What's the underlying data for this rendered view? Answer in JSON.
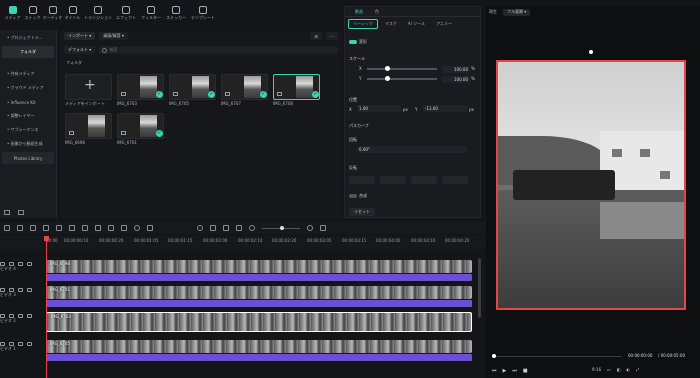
{
  "media_tabs": [
    {
      "label": "メディア",
      "icon": "media-icon",
      "active": true
    },
    {
      "label": "ストック",
      "icon": "stock-icon"
    },
    {
      "label": "オーディオ",
      "icon": "audio-icon"
    },
    {
      "label": "タイトル",
      "icon": "title-icon"
    },
    {
      "label": "トランジション",
      "icon": "transition-icon"
    },
    {
      "label": "エフェクト",
      "icon": "effect-icon"
    },
    {
      "label": "フィルター",
      "icon": "filter-icon"
    },
    {
      "label": "ステッカー",
      "icon": "sticker-icon"
    },
    {
      "label": "テンプレート",
      "icon": "template-icon"
    }
  ],
  "sidebar": {
    "items": [
      {
        "label": "• プロジェクトメ..."
      },
      {
        "label": "フォルダ",
        "selected": true
      },
      {
        "label": "• 共有メディア"
      },
      {
        "label": "• クラウド メディア"
      },
      {
        "label": "• Influence Kit"
      },
      {
        "label": "• 調整レイヤー"
      },
      {
        "label": "• サブシーケンス"
      },
      {
        "label": "• 画像から動画生成"
      }
    ],
    "library": "Photos Library"
  },
  "browser": {
    "import_btn": "インポート ▾",
    "record_btn": "録画/録音 ▾",
    "sort": "デフォルト ▾",
    "search_placeholder": "検索",
    "folder_label": "フォルダ",
    "items": [
      {
        "name": "メディアをインポート",
        "import": true
      },
      {
        "name": "IMG_6703",
        "checked": true
      },
      {
        "name": "IMG_6705",
        "checked": true
      },
      {
        "name": "IMG_6707",
        "checked": true
      },
      {
        "name": "IMG_6708",
        "checked": true,
        "selected": true
      },
      {
        "name": "IMG_6698",
        "checked": false
      },
      {
        "name": "IMG_6701",
        "checked": true
      }
    ]
  },
  "props": {
    "tabs": [
      "動画",
      "色"
    ],
    "subtabs": [
      "ベーシック",
      "マスク",
      "AI ツール",
      "アニメー"
    ],
    "transform_label": "変形",
    "scale_label": "スケール",
    "x_label": "X",
    "y_label": "Y",
    "scale_x": "100.00",
    "scale_y": "100.00",
    "pct": "%",
    "position_label": "位置",
    "pos_x": "1.00",
    "pos_y": "-11.00",
    "px": "px",
    "path_curve": "パスカーブ",
    "rotate_label": "回転",
    "rotate_val": "0.00°",
    "flip_label": "反転",
    "composite_label": "合成",
    "reset": "リセット"
  },
  "preview": {
    "play_label": "再生",
    "quality": "フル画質 ▾",
    "time_current": "00:00:00:00",
    "time_total": "/ 00:00:05:00",
    "ratio": "9:16"
  },
  "ruler": [
    "00:00",
    "00:00:00:10",
    "00:00:00:20",
    "00:00:01:05",
    "00:00:01:15",
    "00:00:02:00",
    "00:00:02:10",
    "00:00:02:20",
    "00:00:03:05",
    "00:00:03:15",
    "00:00:04:00",
    "00:00:04:10",
    "00:00:04:20"
  ],
  "tracks": [
    {
      "head": "ビデオ 4",
      "clip": "IMG_6698"
    },
    {
      "head": "ビデオ 3",
      "clip": "IMG_6701"
    },
    {
      "head": "ビデオ 2",
      "clip": "IMG_6703",
      "selected": true
    },
    {
      "head": "ビデオ 1",
      "clip": "IMG_6705"
    }
  ],
  "colors": {
    "accent": "#3ad4b0",
    "selection": "#e0464b",
    "audio": "#6b4fd6"
  }
}
